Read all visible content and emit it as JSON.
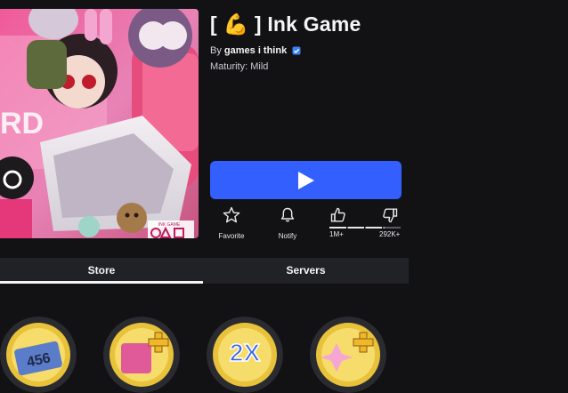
{
  "game": {
    "title_open": "[",
    "title_emoji": "💪",
    "title_close": "]",
    "title_text": "Ink Game",
    "by_prefix": "By",
    "creator": "games i think",
    "maturity": "Maturity: Mild"
  },
  "thumbnail": {
    "badge_text": "INK GAME"
  },
  "actions": {
    "favorite_label": "Favorite",
    "notify_label": "Notify",
    "likes": "1M+",
    "dislikes": "292K+",
    "like_ratio": 0.77
  },
  "tabs": [
    {
      "label": "Store",
      "active": true
    },
    {
      "label": "Servers",
      "active": false
    }
  ],
  "store_items": [
    {
      "icon": "counter-badge-icon",
      "label": "456"
    },
    {
      "icon": "plus-item-icon",
      "label": ""
    },
    {
      "icon": "2x-boost-icon",
      "label": "2X"
    },
    {
      "icon": "sparkle-plus-icon",
      "label": ""
    }
  ],
  "colors": {
    "background": "#121215",
    "play_button": "#335fff",
    "tab_bar": "#212226",
    "verified": "#3b82f6"
  }
}
